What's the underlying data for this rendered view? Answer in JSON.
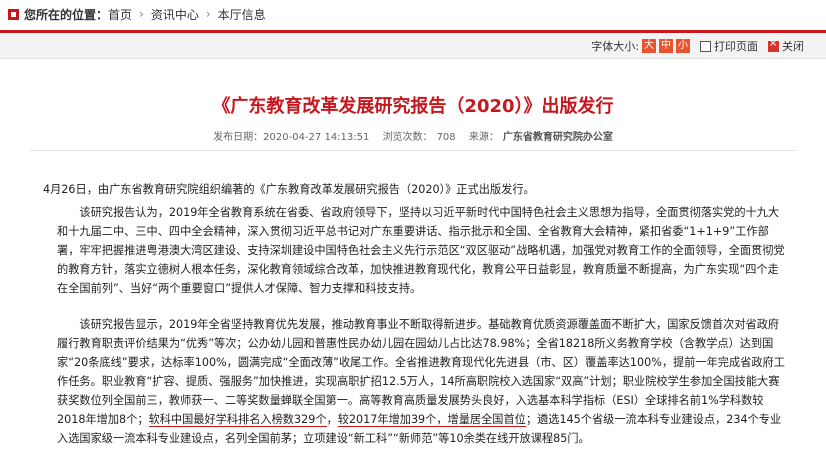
{
  "breadcrumb": {
    "location_label": "您所在的位置：",
    "items": [
      "首页",
      "资讯中心",
      "本厅信息"
    ],
    "separator": "›"
  },
  "toolbar": {
    "font_size_label": "字体大小:",
    "font_buttons": [
      "大",
      "中",
      "小"
    ],
    "print_label": "打印页面",
    "close_label": "关闭"
  },
  "article": {
    "title": "《广东教育改革发展研究报告（2020）》出版发行",
    "meta": {
      "publish_label": "发布日期：",
      "publish_time": "2020-04-27 14:13:51",
      "views_label": "浏览次数：",
      "views": "708",
      "source_label": "来源：",
      "source": "广东省教育研究院办公室"
    },
    "p1": "4月26日，由广东省教育研究院组织编著的《广东教育改革发展研究报告（2020）》正式出版发行。",
    "p2": "该研究报告认为，2019年全省教育系统在省委、省政府领导下，坚持以习近平新时代中国特色社会主义思想为指导，全面贯彻落实党的十九大和十九届二中、三中、四中全会精神，深入贯彻习近平总书记对广东重要讲话、指示批示和全国、全省教育大会精神，紧扣省委“1+1+9”工作部署，牢牢把握推进粤港澳大湾区建设、支持深圳建设中国特色社会主义先行示范区“双区驱动”战略机遇，加强党对教育工作的全面领导，全面贯彻党的教育方针，落实立德树人根本任务，深化教育领域综合改革，加快推进教育现代化，教育公平日益彰显，教育质量不断提高，为广东实现“四个走在全国前列”、当好“两个重要窗口”提供人才保障、智力支撑和科技支持。",
    "p3_a": "该研究报告显示，2019年全省坚持教育优先发展，推动教育事业不断取得新进步。基础教育优质资源覆盖面不断扩大，国家反馈首次对省政府履行教育职责评价结果为“优秀”等次；公办幼儿园和普惠性民办幼儿园在园幼儿占比达78.98%；全省18218所义务教育学校（含教学点）达到国家“20条底线”要求，达标率100%，圆满完成“全面改薄”收尾工作。全省推进教育现代化先进县（市、区）覆盖率达100%，提前一年完成省政府工作任务。职业教育“扩容、提质、强服务”加快推进，实现高职扩招12.5万人，14所高职院校入选国家“双高”计划；职业院校学生参加全国技能大赛获奖数位列全国前三，教师获一、二等奖数量蝉联全国第一。高等教育高质量发展势头良好，入选基本科学指标（ESI）全球排名前1%学科数较2018年增加8个；",
    "p3_u1": "软科中国最好学科排名入榜数329个",
    "p3_b": "，",
    "p3_u2": "较2017年增加39个，增量居全国首位",
    "p3_c": "；遴选145个省级一流本科专业建设点，234个专业入选国家级一流本科专业建设点，名列全国前茅；立项建设“新工科”“新师范”等10余类在线开放课程85门。"
  },
  "colors": {
    "accent": "#c8161d",
    "font_button": "#e8542d"
  }
}
